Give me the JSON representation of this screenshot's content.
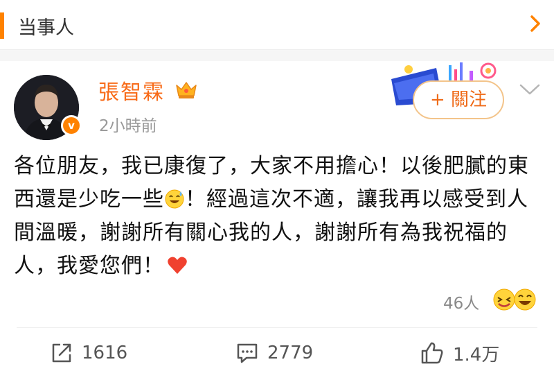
{
  "header": {
    "title": "当事人"
  },
  "post": {
    "author": "張智霖",
    "time": "2小時前",
    "follow_label": "+ 關注",
    "verified_badge": "v",
    "content_part1": "各位朋友，我已康復了，大家不用擔心！以後肥膩的東西還是少吃一些",
    "content_part2": "！經過這次不適，讓我再以感受到人間溫暖，謝謝所有關心我的人，謝謝所有為我祝福的人，我愛您們！",
    "reaction_count": "46人"
  },
  "actions": {
    "share_count": "1616",
    "comment_count": "2779",
    "like_count": "1.4万"
  },
  "colors": {
    "accent": "#ff8200",
    "name": "#f86b19",
    "follow": "#ef6a17"
  },
  "icons": [
    "chevron-right-icon",
    "crown-icon",
    "chevron-down-icon",
    "sweat-smile-emoji",
    "heart-emoji",
    "share-icon",
    "comment-icon",
    "thumbs-up-icon"
  ]
}
